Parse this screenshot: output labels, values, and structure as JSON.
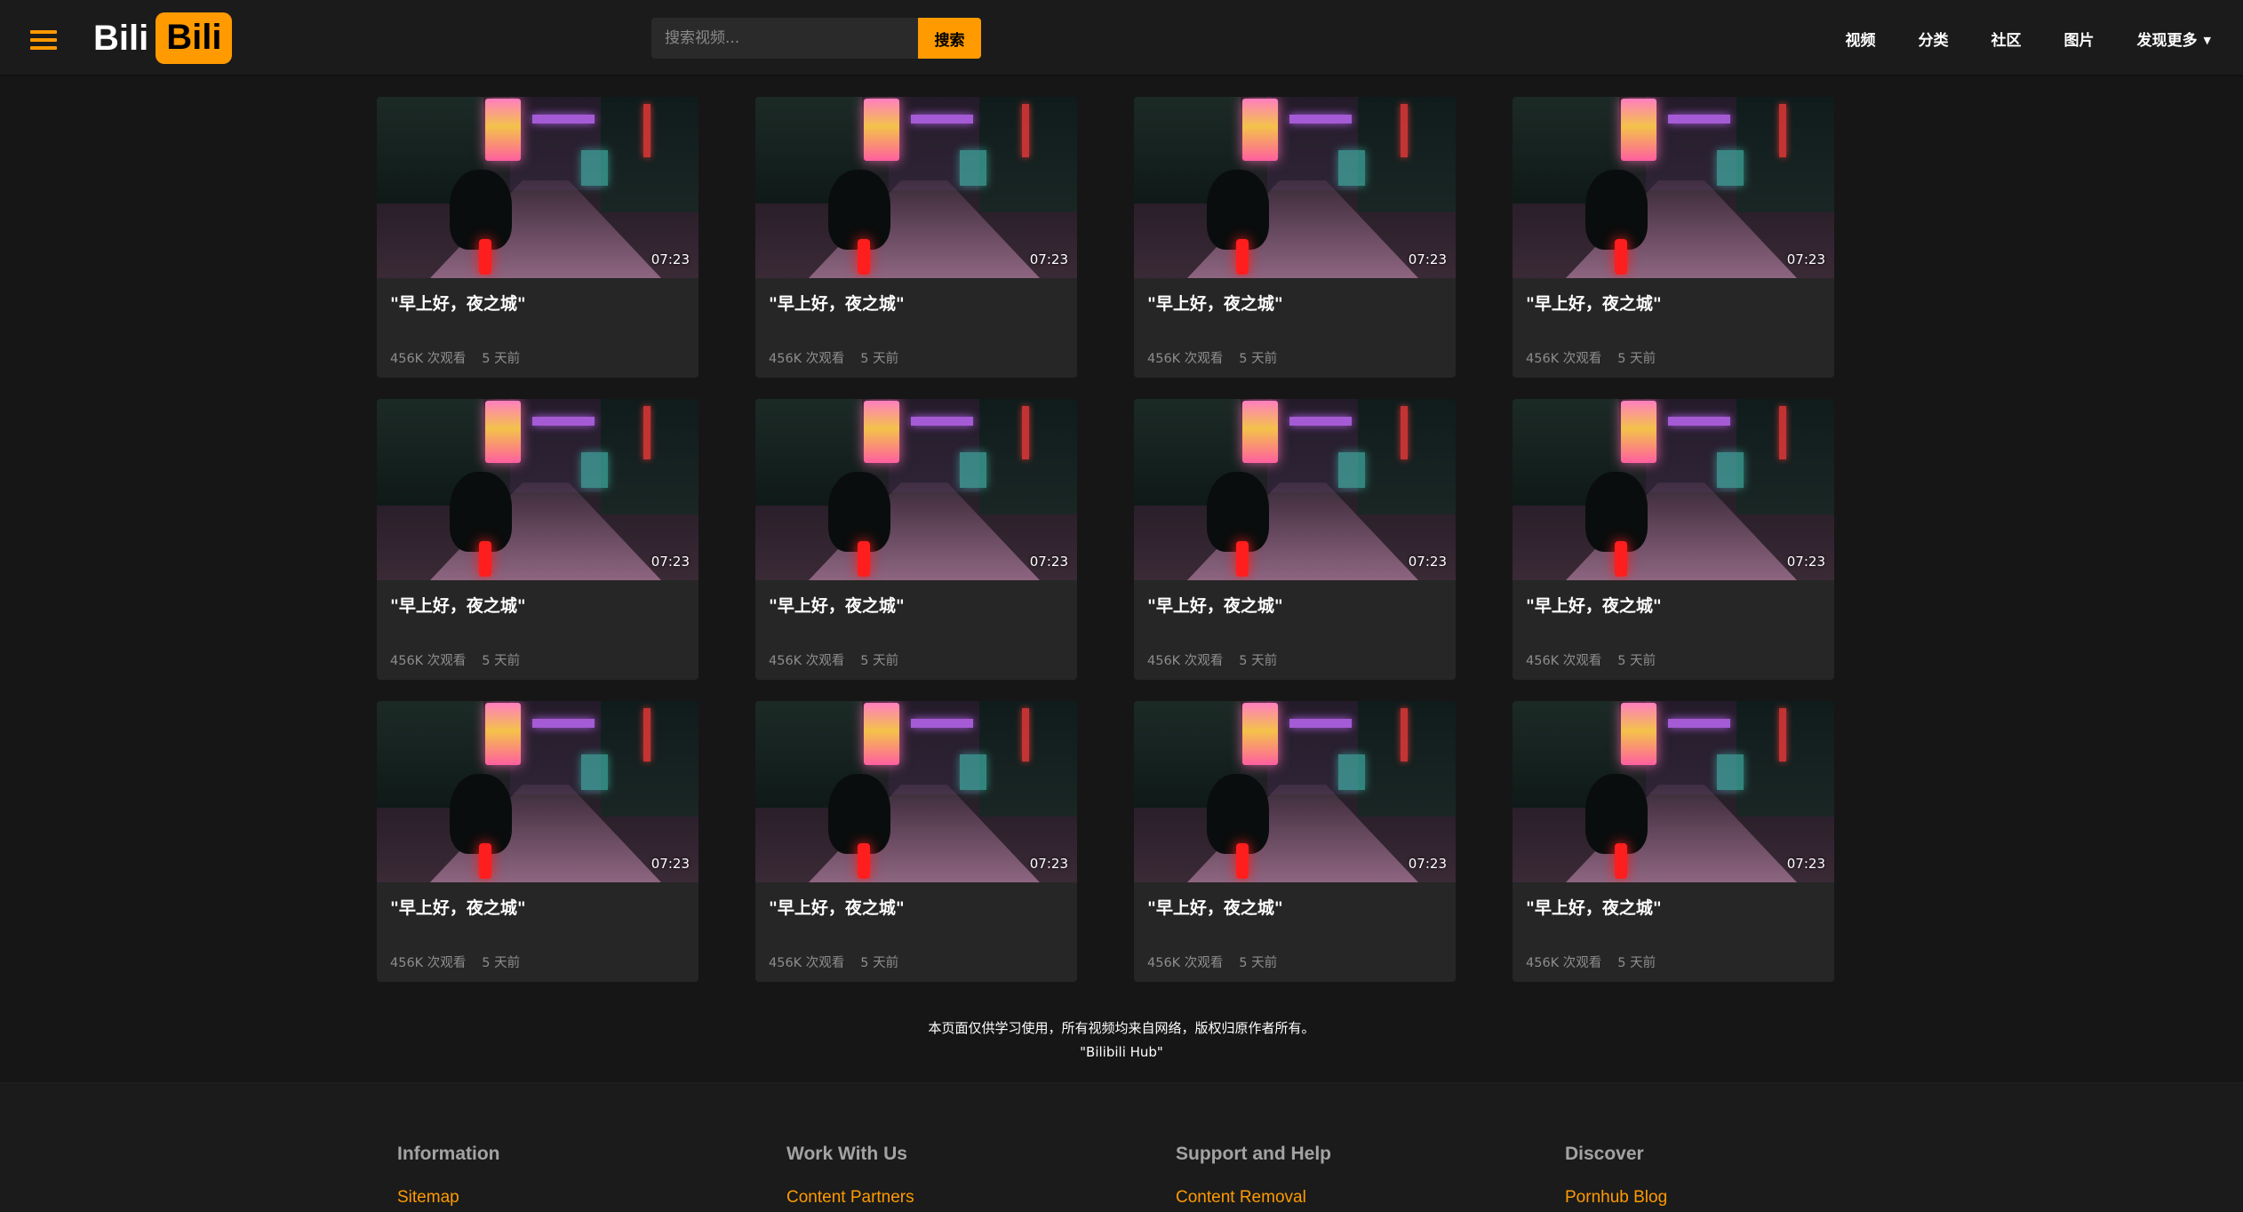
{
  "header": {
    "logo_left": "Bili",
    "logo_right": "Bili",
    "search_placeholder": "搜索视频...",
    "search_button": "搜索",
    "nav": [
      "视频",
      "分类",
      "社区",
      "图片"
    ],
    "nav_more": "发现更多",
    "accent_color": "#ff9a00"
  },
  "videos": [
    {
      "title": "\"早上好，夜之城\"",
      "views": "456K 次观看",
      "age": "5 天前",
      "duration": "07:23"
    },
    {
      "title": "\"早上好，夜之城\"",
      "views": "456K 次观看",
      "age": "5 天前",
      "duration": "07:23"
    },
    {
      "title": "\"早上好，夜之城\"",
      "views": "456K 次观看",
      "age": "5 天前",
      "duration": "07:23"
    },
    {
      "title": "\"早上好，夜之城\"",
      "views": "456K 次观看",
      "age": "5 天前",
      "duration": "07:23"
    },
    {
      "title": "\"早上好，夜之城\"",
      "views": "456K 次观看",
      "age": "5 天前",
      "duration": "07:23"
    },
    {
      "title": "\"早上好，夜之城\"",
      "views": "456K 次观看",
      "age": "5 天前",
      "duration": "07:23"
    },
    {
      "title": "\"早上好，夜之城\"",
      "views": "456K 次观看",
      "age": "5 天前",
      "duration": "07:23"
    },
    {
      "title": "\"早上好，夜之城\"",
      "views": "456K 次观看",
      "age": "5 天前",
      "duration": "07:23"
    },
    {
      "title": "\"早上好，夜之城\"",
      "views": "456K 次观看",
      "age": "5 天前",
      "duration": "07:23"
    },
    {
      "title": "\"早上好，夜之城\"",
      "views": "456K 次观看",
      "age": "5 天前",
      "duration": "07:23"
    },
    {
      "title": "\"早上好，夜之城\"",
      "views": "456K 次观看",
      "age": "5 天前",
      "duration": "07:23"
    },
    {
      "title": "\"早上好，夜之城\"",
      "views": "456K 次观看",
      "age": "5 天前",
      "duration": "07:23"
    }
  ],
  "notice": {
    "line1": "本页面仅供学习使用，所有视频均来自网络，版权归原作者所有。",
    "line2": "\"Bilibili Hub\""
  },
  "footer": {
    "columns": [
      {
        "heading": "Information",
        "link": "Sitemap"
      },
      {
        "heading": "Work With Us",
        "link": "Content Partners"
      },
      {
        "heading": "Support and Help",
        "link": "Content Removal"
      },
      {
        "heading": "Discover",
        "link": "Pornhub Blog"
      }
    ]
  }
}
